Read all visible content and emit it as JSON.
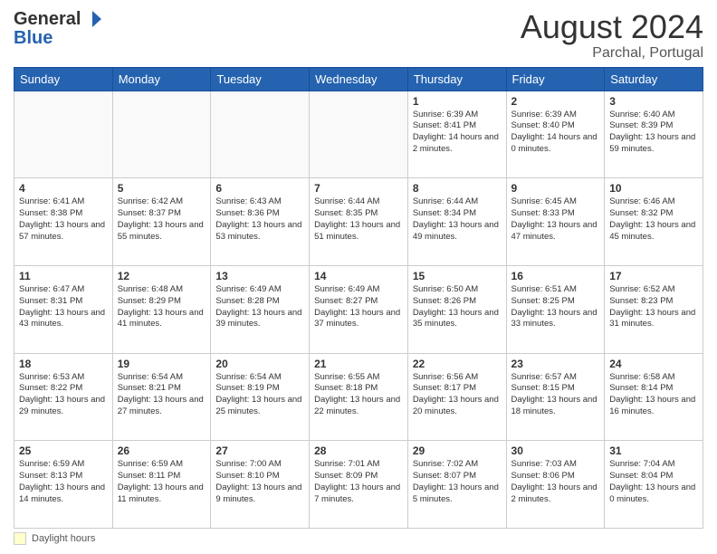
{
  "header": {
    "logo_line1": "General",
    "logo_line2": "Blue",
    "main_title": "August 2024",
    "subtitle": "Parchal, Portugal"
  },
  "days_of_week": [
    "Sunday",
    "Monday",
    "Tuesday",
    "Wednesday",
    "Thursday",
    "Friday",
    "Saturday"
  ],
  "weeks": [
    [
      {
        "day": "",
        "content": ""
      },
      {
        "day": "",
        "content": ""
      },
      {
        "day": "",
        "content": ""
      },
      {
        "day": "",
        "content": ""
      },
      {
        "day": "1",
        "content": "Sunrise: 6:39 AM\nSunset: 8:41 PM\nDaylight: 14 hours and 2 minutes."
      },
      {
        "day": "2",
        "content": "Sunrise: 6:39 AM\nSunset: 8:40 PM\nDaylight: 14 hours and 0 minutes."
      },
      {
        "day": "3",
        "content": "Sunrise: 6:40 AM\nSunset: 8:39 PM\nDaylight: 13 hours and 59 minutes."
      }
    ],
    [
      {
        "day": "4",
        "content": "Sunrise: 6:41 AM\nSunset: 8:38 PM\nDaylight: 13 hours and 57 minutes."
      },
      {
        "day": "5",
        "content": "Sunrise: 6:42 AM\nSunset: 8:37 PM\nDaylight: 13 hours and 55 minutes."
      },
      {
        "day": "6",
        "content": "Sunrise: 6:43 AM\nSunset: 8:36 PM\nDaylight: 13 hours and 53 minutes."
      },
      {
        "day": "7",
        "content": "Sunrise: 6:44 AM\nSunset: 8:35 PM\nDaylight: 13 hours and 51 minutes."
      },
      {
        "day": "8",
        "content": "Sunrise: 6:44 AM\nSunset: 8:34 PM\nDaylight: 13 hours and 49 minutes."
      },
      {
        "day": "9",
        "content": "Sunrise: 6:45 AM\nSunset: 8:33 PM\nDaylight: 13 hours and 47 minutes."
      },
      {
        "day": "10",
        "content": "Sunrise: 6:46 AM\nSunset: 8:32 PM\nDaylight: 13 hours and 45 minutes."
      }
    ],
    [
      {
        "day": "11",
        "content": "Sunrise: 6:47 AM\nSunset: 8:31 PM\nDaylight: 13 hours and 43 minutes."
      },
      {
        "day": "12",
        "content": "Sunrise: 6:48 AM\nSunset: 8:29 PM\nDaylight: 13 hours and 41 minutes."
      },
      {
        "day": "13",
        "content": "Sunrise: 6:49 AM\nSunset: 8:28 PM\nDaylight: 13 hours and 39 minutes."
      },
      {
        "day": "14",
        "content": "Sunrise: 6:49 AM\nSunset: 8:27 PM\nDaylight: 13 hours and 37 minutes."
      },
      {
        "day": "15",
        "content": "Sunrise: 6:50 AM\nSunset: 8:26 PM\nDaylight: 13 hours and 35 minutes."
      },
      {
        "day": "16",
        "content": "Sunrise: 6:51 AM\nSunset: 8:25 PM\nDaylight: 13 hours and 33 minutes."
      },
      {
        "day": "17",
        "content": "Sunrise: 6:52 AM\nSunset: 8:23 PM\nDaylight: 13 hours and 31 minutes."
      }
    ],
    [
      {
        "day": "18",
        "content": "Sunrise: 6:53 AM\nSunset: 8:22 PM\nDaylight: 13 hours and 29 minutes."
      },
      {
        "day": "19",
        "content": "Sunrise: 6:54 AM\nSunset: 8:21 PM\nDaylight: 13 hours and 27 minutes."
      },
      {
        "day": "20",
        "content": "Sunrise: 6:54 AM\nSunset: 8:19 PM\nDaylight: 13 hours and 25 minutes."
      },
      {
        "day": "21",
        "content": "Sunrise: 6:55 AM\nSunset: 8:18 PM\nDaylight: 13 hours and 22 minutes."
      },
      {
        "day": "22",
        "content": "Sunrise: 6:56 AM\nSunset: 8:17 PM\nDaylight: 13 hours and 20 minutes."
      },
      {
        "day": "23",
        "content": "Sunrise: 6:57 AM\nSunset: 8:15 PM\nDaylight: 13 hours and 18 minutes."
      },
      {
        "day": "24",
        "content": "Sunrise: 6:58 AM\nSunset: 8:14 PM\nDaylight: 13 hours and 16 minutes."
      }
    ],
    [
      {
        "day": "25",
        "content": "Sunrise: 6:59 AM\nSunset: 8:13 PM\nDaylight: 13 hours and 14 minutes."
      },
      {
        "day": "26",
        "content": "Sunrise: 6:59 AM\nSunset: 8:11 PM\nDaylight: 13 hours and 11 minutes."
      },
      {
        "day": "27",
        "content": "Sunrise: 7:00 AM\nSunset: 8:10 PM\nDaylight: 13 hours and 9 minutes."
      },
      {
        "day": "28",
        "content": "Sunrise: 7:01 AM\nSunset: 8:09 PM\nDaylight: 13 hours and 7 minutes."
      },
      {
        "day": "29",
        "content": "Sunrise: 7:02 AM\nSunset: 8:07 PM\nDaylight: 13 hours and 5 minutes."
      },
      {
        "day": "30",
        "content": "Sunrise: 7:03 AM\nSunset: 8:06 PM\nDaylight: 13 hours and 2 minutes."
      },
      {
        "day": "31",
        "content": "Sunrise: 7:04 AM\nSunset: 8:04 PM\nDaylight: 13 hours and 0 minutes."
      }
    ]
  ],
  "footer": {
    "daylight_label": "Daylight hours"
  }
}
